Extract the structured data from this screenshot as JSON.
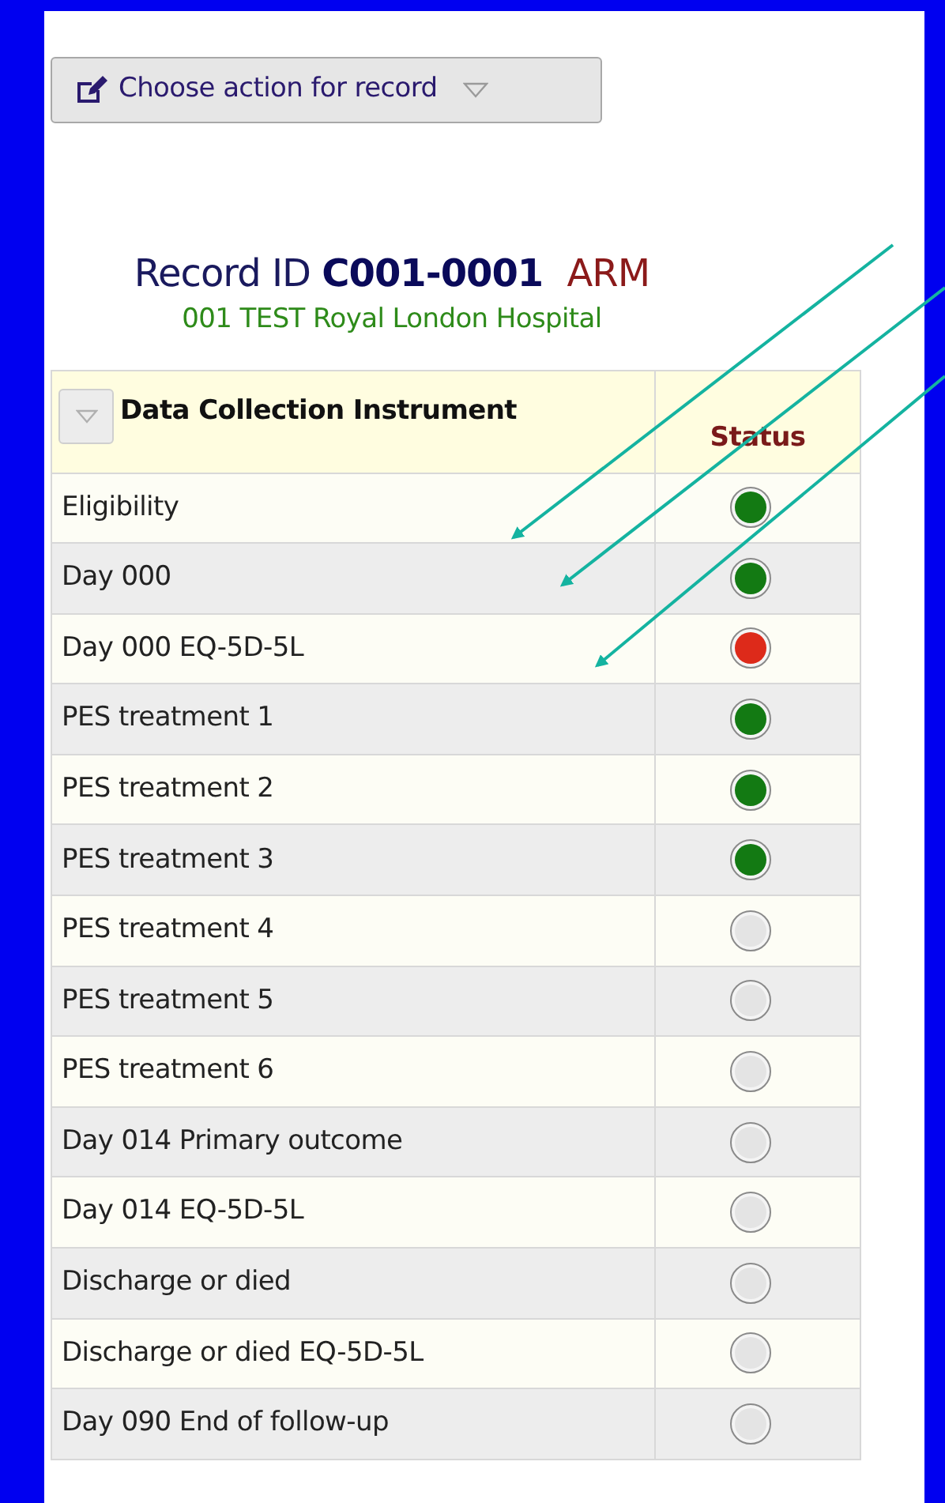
{
  "action_button": {
    "label": "Choose action for record"
  },
  "record": {
    "label": "Record ID",
    "id": "C001-0001",
    "arm": "ARM",
    "site": "001 TEST Royal London Hospital"
  },
  "table": {
    "columns": [
      "Data Collection Instrument",
      "Status"
    ],
    "rows": [
      {
        "instrument": "Eligibility",
        "color": "#137a13"
      },
      {
        "instrument": "Day 000",
        "color": "#137a13"
      },
      {
        "instrument": "Day 000 EQ-5D-5L",
        "color": "#dd2a1a"
      },
      {
        "instrument": "PES treatment 1",
        "color": "#137a13"
      },
      {
        "instrument": "PES treatment 2",
        "color": "#137a13"
      },
      {
        "instrument": "PES treatment 3",
        "color": "#137a13"
      },
      {
        "instrument": "PES treatment 4",
        "color": "#e4e4e4"
      },
      {
        "instrument": "PES treatment 5",
        "color": "#e4e4e4"
      },
      {
        "instrument": "PES treatment 6",
        "color": "#e4e4e4"
      },
      {
        "instrument": "Day 014 Primary outcome",
        "color": "#e4e4e4"
      },
      {
        "instrument": "Day 014 EQ-5D-5L",
        "color": "#e4e4e4"
      },
      {
        "instrument": "Discharge or died",
        "color": "#e4e4e4"
      },
      {
        "instrument": "Discharge or died EQ-5D-5L",
        "color": "#e4e4e4"
      },
      {
        "instrument": "Day 090 End of follow-up",
        "color": "#e4e4e4"
      }
    ]
  }
}
